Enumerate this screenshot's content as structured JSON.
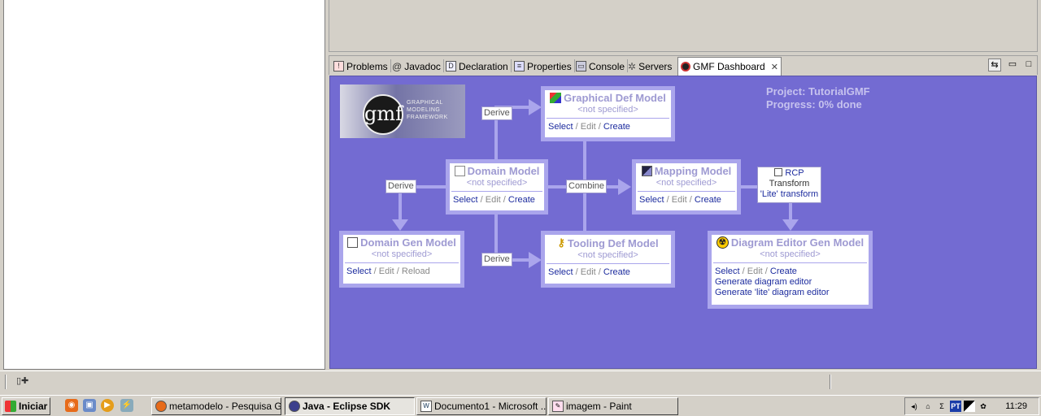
{
  "tabs": [
    {
      "label": "Problems",
      "icon": "problems-icon"
    },
    {
      "label": "Javadoc",
      "icon": "javadoc-icon"
    },
    {
      "label": "Declaration",
      "icon": "declaration-icon"
    },
    {
      "label": "Properties",
      "icon": "properties-icon"
    },
    {
      "label": "Console",
      "icon": "console-icon"
    },
    {
      "label": "Servers",
      "icon": "servers-icon"
    },
    {
      "label": "GMF Dashboard",
      "icon": "gmf-dashboard-icon",
      "active": true
    }
  ],
  "dashboard": {
    "logo_text": "GRAPHICAL MODELING FRAMEWORK",
    "logo_mark": "gmf",
    "project": "Project: TutorialGMF",
    "progress": "Progress: 0% done",
    "not_specified": "<not specified>",
    "labels": {
      "derive_graphical": "Derive",
      "derive_domain_gen": "Derive",
      "derive_tooling": "Derive",
      "combine": "Combine"
    },
    "actions": {
      "select": "Select",
      "edit": "Edit",
      "create": "Create",
      "reload": "Reload",
      "sep": " / "
    },
    "graphical": {
      "title": "Graphical Def Model",
      "not_specified": "<not specified>"
    },
    "domain": {
      "title": "Domain Model",
      "not_specified": "<not specified>"
    },
    "mapping": {
      "title": "Mapping Model",
      "not_specified": "<not specified>"
    },
    "domain_gen": {
      "title": "Domain Gen Model",
      "not_specified": "<not specified>"
    },
    "tooling": {
      "title": "Tooling Def Model",
      "not_specified": "<not specified>"
    },
    "diagram_gen": {
      "title": "Diagram Editor Gen Model",
      "not_specified": "<not specified>",
      "generate": "Generate diagram editor",
      "generate_lite": "Generate 'lite' diagram editor"
    },
    "rcp": {
      "label": "RCP",
      "transform": "Transform",
      "lite_transform": "'Lite' transform"
    }
  },
  "taskbar": {
    "start": "Iniciar",
    "tasks": [
      {
        "label": "metamodelo - Pesquisa G...",
        "icon": "firefox-icon"
      },
      {
        "label": "Java - Eclipse SDK",
        "icon": "eclipse-icon",
        "active": true
      },
      {
        "label": "Documento1 - Microsoft ...",
        "icon": "word-icon"
      },
      {
        "label": "imagem - Paint",
        "icon": "paint-icon"
      }
    ],
    "tray_lang": "PT",
    "clock": "11:29"
  },
  "colors": {
    "dashboard_bg": "#736bd2",
    "connector": "#aaa5ec",
    "link": "#1c2b9e"
  }
}
